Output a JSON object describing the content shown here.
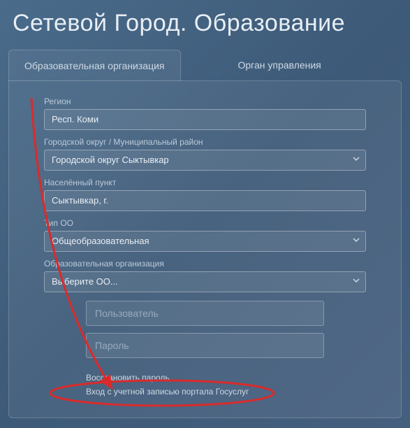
{
  "title": "Сетевой Город. Образование",
  "tabs": {
    "org": "Образовательная организация",
    "gov": "Орган управления"
  },
  "fields": {
    "region": {
      "label": "Регион",
      "value": "Респ. Коми"
    },
    "district": {
      "label": "Городской округ / Муниципальный район",
      "value": "Городской округ Сыктывкар"
    },
    "locality": {
      "label": "Населённый пункт",
      "value": "Сыктывкар, г."
    },
    "orgtype": {
      "label": "Тип ОО",
      "value": "Общеобразовательная"
    },
    "org": {
      "label": "Образовательная организация",
      "value": "Выберите ОО..."
    }
  },
  "inputs": {
    "user_placeholder": "Пользователь",
    "password_placeholder": "Пароль"
  },
  "links": {
    "recover": "Восстановить пароль",
    "gosuslugi": "Вход с учетной записью портала Госуслуг"
  },
  "annotation": {
    "color": "#d92b2b"
  }
}
